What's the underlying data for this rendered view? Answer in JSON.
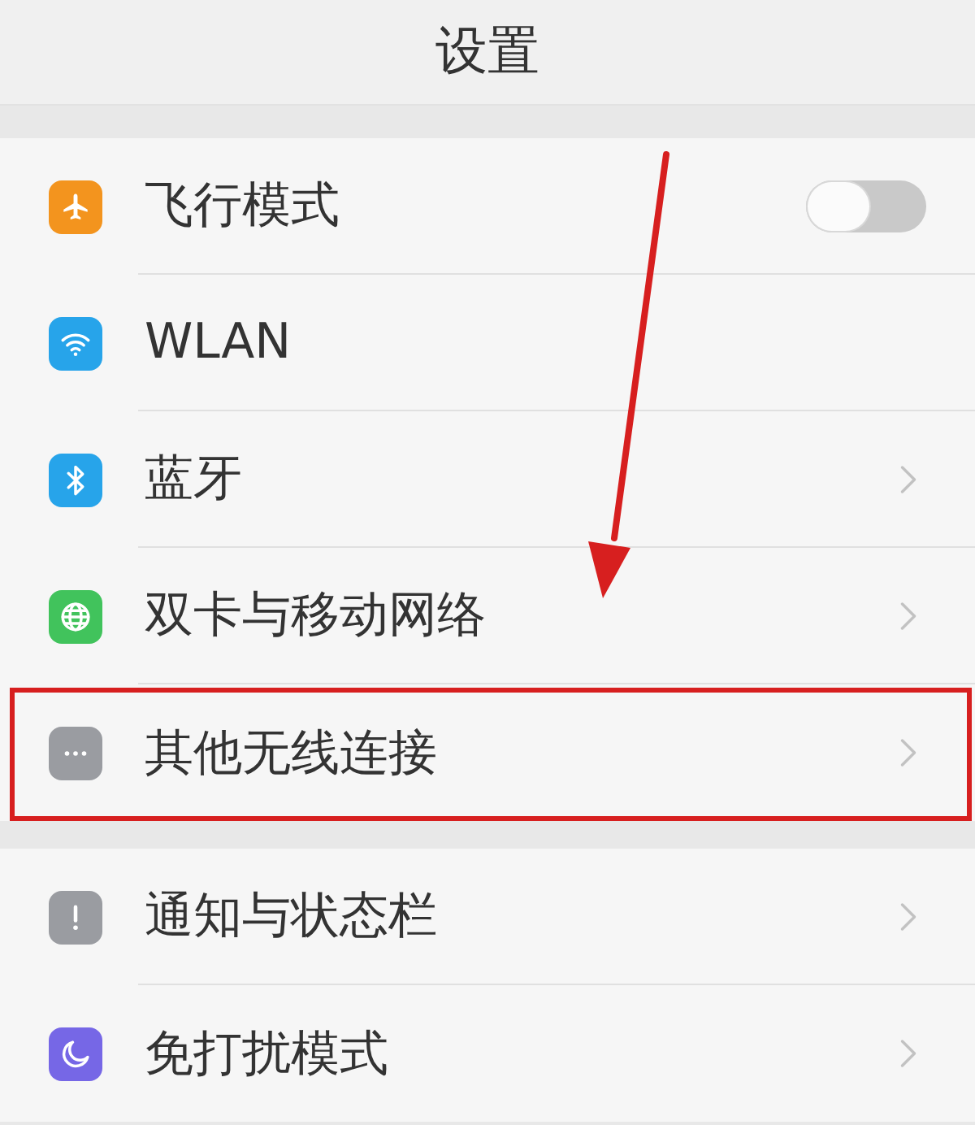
{
  "header": {
    "title": "设置"
  },
  "groups": [
    {
      "rows": [
        {
          "kind": "toggle",
          "label": "飞行模式",
          "color": "#f3941e",
          "on": false,
          "highlighted": false
        },
        {
          "kind": "plain",
          "label": "WLAN",
          "color": "#27a4ea",
          "highlighted": false
        },
        {
          "kind": "link",
          "label": "蓝牙",
          "color": "#27a4ea",
          "highlighted": false
        },
        {
          "kind": "link",
          "label": "双卡与移动网络",
          "color": "#41c35c",
          "highlighted": false
        },
        {
          "kind": "link",
          "label": "其他无线连接",
          "color": "#9a9ca1",
          "highlighted": true
        }
      ]
    },
    {
      "rows": [
        {
          "kind": "link",
          "label": "通知与状态栏",
          "color": "#9a9ca1",
          "highlighted": false
        },
        {
          "kind": "link",
          "label": "免打扰模式",
          "color": "#7667e6",
          "highlighted": false
        }
      ]
    }
  ]
}
